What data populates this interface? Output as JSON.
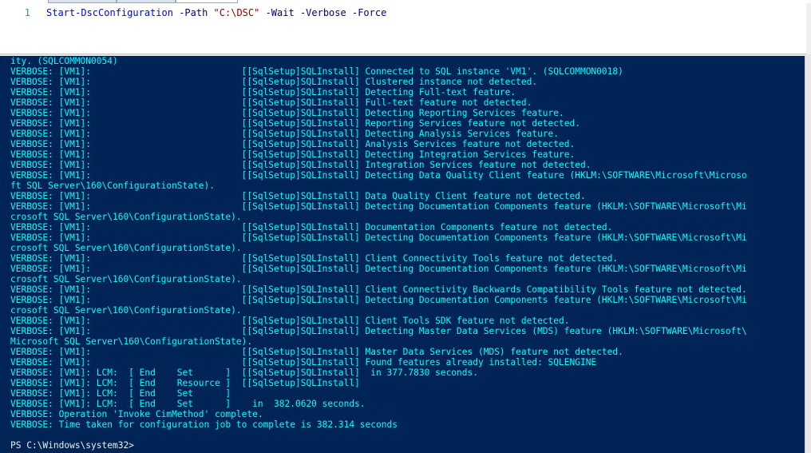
{
  "editor": {
    "line_number": "1",
    "command": "Start-DscConfiguration",
    "param_path": "-Path",
    "path_value": "\"C:\\DSC\"",
    "param_wait": "-Wait",
    "param_verbose": "-Verbose",
    "param_force": "-Force"
  },
  "console": {
    "lines": [
      "ity. (SQLCOMMON0054)",
      "VERBOSE: [VM1]:                            [[SqlSetup]SQLInstall] Connected to SQL instance 'VM1'. (SQLCOMMON0018)",
      "VERBOSE: [VM1]:                            [[SqlSetup]SQLInstall] Clustered instance not detected.",
      "VERBOSE: [VM1]:                            [[SqlSetup]SQLInstall] Detecting Full-text feature.",
      "VERBOSE: [VM1]:                            [[SqlSetup]SQLInstall] Full-text feature not detected.",
      "VERBOSE: [VM1]:                            [[SqlSetup]SQLInstall] Detecting Reporting Services feature.",
      "VERBOSE: [VM1]:                            [[SqlSetup]SQLInstall] Reporting Services feature not detected.",
      "VERBOSE: [VM1]:                            [[SqlSetup]SQLInstall] Detecting Analysis Services feature.",
      "VERBOSE: [VM1]:                            [[SqlSetup]SQLInstall] Analysis Services feature not detected.",
      "VERBOSE: [VM1]:                            [[SqlSetup]SQLInstall] Detecting Integration Services feature.",
      "VERBOSE: [VM1]:                            [[SqlSetup]SQLInstall] Integration Services feature not detected.",
      "VERBOSE: [VM1]:                            [[SqlSetup]SQLInstall] Detecting Data Quality Client feature (HKLM:\\SOFTWARE\\Microsoft\\Microso",
      "ft SQL Server\\160\\ConfigurationState).",
      "VERBOSE: [VM1]:                            [[SqlSetup]SQLInstall] Data Quality Client feature not detected.",
      "VERBOSE: [VM1]:                            [[SqlSetup]SQLInstall] Detecting Documentation Components feature (HKLM:\\SOFTWARE\\Microsoft\\Mi",
      "crosoft SQL Server\\160\\ConfigurationState).",
      "VERBOSE: [VM1]:                            [[SqlSetup]SQLInstall] Documentation Components feature not detected.",
      "VERBOSE: [VM1]:                            [[SqlSetup]SQLInstall] Detecting Documentation Components feature (HKLM:\\SOFTWARE\\Microsoft\\Mi",
      "crosoft SQL Server\\160\\ConfigurationState).",
      "VERBOSE: [VM1]:                            [[SqlSetup]SQLInstall] Client Connectivity Tools feature not detected.",
      "VERBOSE: [VM1]:                            [[SqlSetup]SQLInstall] Detecting Documentation Components feature (HKLM:\\SOFTWARE\\Microsoft\\Mi",
      "crosoft SQL Server\\160\\ConfigurationState).",
      "VERBOSE: [VM1]:                            [[SqlSetup]SQLInstall] Client Connectivity Backwards Compatibility Tools feature not detected.",
      "VERBOSE: [VM1]:                            [[SqlSetup]SQLInstall] Detecting Documentation Components feature (HKLM:\\SOFTWARE\\Microsoft\\Mi",
      "crosoft SQL Server\\160\\ConfigurationState).",
      "VERBOSE: [VM1]:                            [[SqlSetup]SQLInstall] Client Tools SDK feature not detected.",
      "VERBOSE: [VM1]:                            [[SqlSetup]SQLInstall] Detecting Master Data Services (MDS) feature (HKLM:\\SOFTWARE\\Microsoft\\",
      "Microsoft SQL Server\\160\\ConfigurationState).",
      "VERBOSE: [VM1]:                            [[SqlSetup]SQLInstall] Master Data Services (MDS) feature not detected.",
      "VERBOSE: [VM1]:                            [[SqlSetup]SQLInstall] Found features already installed: SQLENGINE",
      "VERBOSE: [VM1]: LCM:  [ End    Set      ]  [[SqlSetup]SQLInstall]  in 377.7830 seconds.",
      "VERBOSE: [VM1]: LCM:  [ End    Resource ]  [[SqlSetup]SQLInstall]",
      "VERBOSE: [VM1]: LCM:  [ End    Set      ]",
      "VERBOSE: [VM1]: LCM:  [ End    Set      ]    in  382.0620 seconds.",
      "VERBOSE: Operation 'Invoke CimMethod' complete.",
      "VERBOSE: Time taken for configuration job to complete is 382.314 seconds"
    ],
    "prompt": "PS C:\\Windows\\system32>"
  },
  "colors": {
    "console_background": "#012456",
    "verbose_text": "#00ffff",
    "prompt_text": "#eeedf0"
  }
}
